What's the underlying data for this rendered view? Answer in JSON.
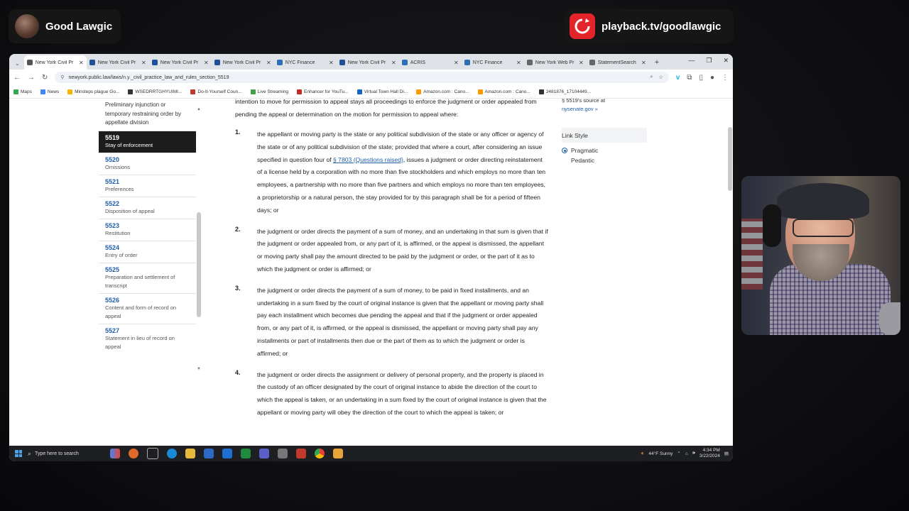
{
  "overlay": {
    "channel_name": "Good Lawgic",
    "playback_url": "playback.tv/goodlawgic"
  },
  "browser": {
    "tabs": [
      {
        "label": "New York Civil Pr",
        "active": true,
        "favicon_color": "#555555"
      },
      {
        "label": "New York Civil Pr",
        "active": false,
        "favicon_color": "#1f4f99"
      },
      {
        "label": "New York Civil Pr",
        "active": false,
        "favicon_color": "#1f4f99"
      },
      {
        "label": "New York Civil Pr",
        "active": false,
        "favicon_color": "#1f4f99"
      },
      {
        "label": "NYC Finance",
        "active": false,
        "favicon_color": "#2f6fb3"
      },
      {
        "label": "New York Civil Pr",
        "active": false,
        "favicon_color": "#1f4f99"
      },
      {
        "label": "ACRIS",
        "active": false,
        "favicon_color": "#2f6fb3"
      },
      {
        "label": "NYC Finance",
        "active": false,
        "favicon_color": "#2f6fb3"
      },
      {
        "label": "New York Web Pr",
        "active": false,
        "favicon_color": "#666666"
      },
      {
        "label": "StatementSearch",
        "active": false,
        "favicon_color": "#666666"
      }
    ],
    "new_tab": "+",
    "url": "newyork.public.law/laws/n.y._civil_practice_law_and_rules_section_5519",
    "bookmarks": [
      {
        "label": "Maps",
        "color": "#34a853"
      },
      {
        "label": "News",
        "color": "#4285f4"
      },
      {
        "label": "Minsteps plague Go...",
        "color": "#f4b400"
      },
      {
        "label": "WSEDRRTGHYUIMI...",
        "color": "#333333"
      },
      {
        "label": "Do-It-Yourself Coun...",
        "color": "#c0392b"
      },
      {
        "label": "Live Streaming",
        "color": "#43a047"
      },
      {
        "label": "Enhancer for YouTu...",
        "color": "#c62828"
      },
      {
        "label": "Virtual Town Hall Di...",
        "color": "#1565c0"
      },
      {
        "label": "Amazon.com : Cano...",
        "color": "#ff9900"
      },
      {
        "label": "Amazon.com : Cano...",
        "color": "#ff9900"
      },
      {
        "label": "2481876_17104449...",
        "color": "#333333"
      }
    ]
  },
  "sidenav": {
    "top_partial": [
      "Preliminary injunction or",
      "temporary restraining order by",
      "appellate division"
    ],
    "items": [
      {
        "num": "5519",
        "desc": [
          "Stay of enforcement"
        ],
        "active": true
      },
      {
        "num": "5520",
        "desc": [
          "Omissions"
        ],
        "active": false
      },
      {
        "num": "5521",
        "desc": [
          "Preferences"
        ],
        "active": false
      },
      {
        "num": "5522",
        "desc": [
          "Disposition of appeal"
        ],
        "active": false
      },
      {
        "num": "5523",
        "desc": [
          "Restitution"
        ],
        "active": false
      },
      {
        "num": "5524",
        "desc": [
          "Entry of order"
        ],
        "active": false
      },
      {
        "num": "5525",
        "desc": [
          "Preparation and settlement of",
          "transcript"
        ],
        "active": false
      },
      {
        "num": "5526",
        "desc": [
          "Content and form of record on",
          "appeal"
        ],
        "active": false
      },
      {
        "num": "5527",
        "desc": [
          "Statement in lieu of record on",
          "appeal"
        ],
        "active": false
      }
    ]
  },
  "main": {
    "intro": "intention to move for permission to appeal stays all proceedings to enforce the judgment or order appealed from pending the appeal or determination on the motion for permission to appeal where:",
    "items": [
      {
        "num": "1.",
        "text_before": "the appellant or moving party is the state or any political subdivision of the state or any officer or agency of the state or of any political subdivision of the state; provided that where a court, after considering an issue specified in question four of ",
        "link": "§ 7803 (Questions raised)",
        "text_after": ", issues a judgment or order directing reinstatement of a license held by a corporation with no more than five stockholders and which employs no more than ten employees, a partnership with no more than five partners and which employs no more than ten employees, a proprietorship or a natural person, the stay provided for by this paragraph shall be for a period of fifteen days; or"
      },
      {
        "num": "2.",
        "text_before": "the judgment or order directs the payment of a sum of money, and an undertaking in that sum is given that if the judgment or order appealed from, or any part of it, is affirmed, or the appeal is dismissed, the appellant or moving party shall pay the amount directed to be paid by the judgment or order, or the part of it as to which the judgment or order is affirmed; or",
        "link": "",
        "text_after": ""
      },
      {
        "num": "3.",
        "text_before": "the judgment or order directs the payment of a sum of money, to be paid in fixed installments, and an undertaking in a sum fixed by the court of original instance is given that the appellant or moving party shall pay each installment which becomes due pending the appeal and that if the judgment or order appealed from, or any part of it, is affirmed, or the appeal is dismissed, the appellant or moving party shall pay any installments or part of installments then due or the part of them as to which the judgment or order is affirmed; or",
        "link": "",
        "text_after": ""
      },
      {
        "num": "4.",
        "text_before": "the judgment or order directs the assignment or delivery of personal property, and the property is placed in the custody of an officer designated by the court of original instance to abide the direction of the court to which the appeal is taken, or an undertaking in a sum fixed by the court of original instance is given that the appellant or moving party will obey the direction of the court to which the appeal is taken; or",
        "link": "",
        "text_after": ""
      }
    ]
  },
  "rightpanel": {
    "source_text": "§ 5519's source at",
    "source_link": "nysenate.gov »",
    "link_style_heading": "Link Style",
    "options": [
      {
        "label": "Pragmatic",
        "selected": true
      },
      {
        "label": "Pedantic",
        "selected": false
      }
    ]
  },
  "taskbar": {
    "search_placeholder": "Type here to search",
    "weather": "44°F  Sunny",
    "time": "4:34 PM",
    "date": "3/22/2024"
  }
}
